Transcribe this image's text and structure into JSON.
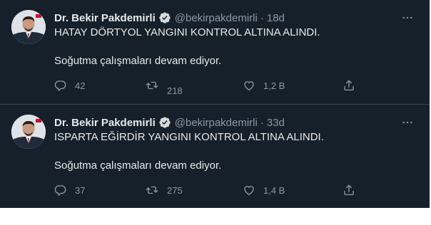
{
  "tweets": [
    {
      "author_name": "Dr. Bekir Pakdemirli",
      "handle": "@bekirpakdemirli",
      "separator": "·",
      "time": "18d",
      "line1": "HATAY DÖRTYOL YANGINI KONTROL ALTINA ALINDI.",
      "line2": "Soğutma çalışmaları devam ediyor.",
      "replies": "42",
      "retweets": "218",
      "likes": "1,2 B"
    },
    {
      "author_name": "Dr. Bekir Pakdemirli",
      "handle": "@bekirpakdemirli",
      "separator": "·",
      "time": "33d",
      "line1": "ISPARTA EĞİRDİR YANGINI KONTROL ALTINA ALINDI.",
      "line2": "Soğutma çalışmaları devam ediyor.",
      "replies": "37",
      "retweets": "275",
      "likes": "1,4 B"
    }
  ],
  "colors": {
    "background": "#15202b",
    "primary_text": "#e7e9ea",
    "secondary_text": "#8b98a5",
    "verified": "#1d9bf0",
    "divider": "#38444d"
  },
  "icons": [
    "verified-badge-icon",
    "more-icon",
    "reply-icon",
    "retweet-icon",
    "like-icon",
    "share-icon"
  ]
}
